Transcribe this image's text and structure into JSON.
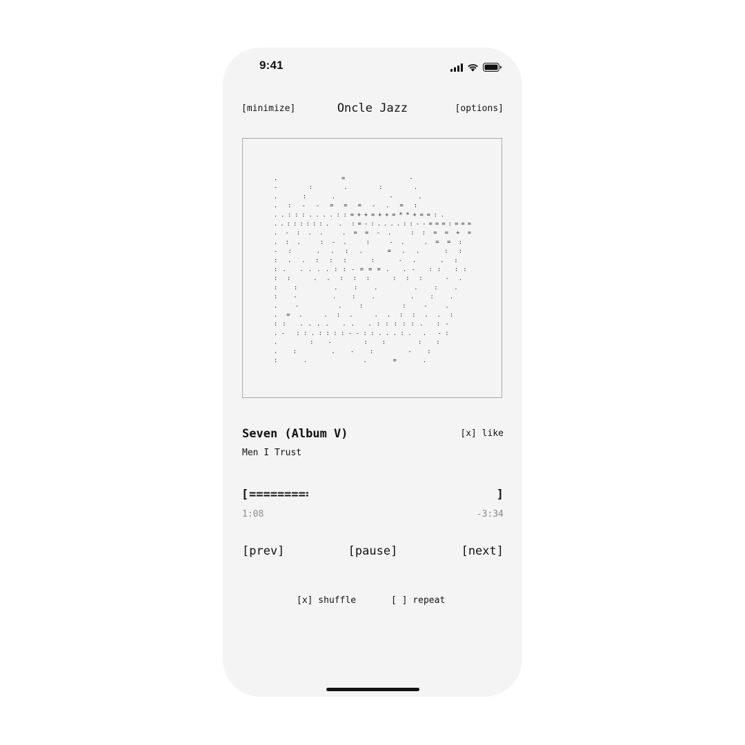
{
  "status_bar": {
    "time": "9:41",
    "icons": [
      "cellular-signal-icon",
      "wifi-icon",
      "battery-icon"
    ]
  },
  "header": {
    "minimize_label": "[minimize]",
    "title": "Oncle Jazz",
    "options_label": "[options]"
  },
  "artwork": {
    "icon": "ascii-art-cover",
    "ascii_lines": [
      "                            .=-",
      "                           -:.:.",
      "                          .:.  -.",
      "                     .:--===-.=:",
      "             ..:::....::=++=++=**+==:.",
      "          ..::::::. .    :=-:....::--===:===",
      "      .-:..            .==-.          ::==+=",
      "     .:.               :-.    :   -.  .==:",
      "     -:                    ..:.   =..   ::",
      "    :..:::                  :   -.     .:",
      "   :.      ....::-===.         .- ::     ::",
      "   ::     ..:::                :::      -.",
      "  ::   .:.                            .:.",
      "  :-  .:.                            .:.",
      " .-  .:                             :-.",
      ".=.   .:.                        ..::..:",
      "::       ....           .. .:::::.   :-",
      ".-          ::.::::--::...:. .       -:",
      " .         :-          ::          ::",
      "          .:         .-:         -:",
      "                     :.        .=."
    ]
  },
  "track": {
    "title": "Seven (Album V)",
    "artist": "Men I Trust",
    "like_label": "[x] like"
  },
  "progress": {
    "open_bracket": "[",
    "fill": "==========================================",
    "close_bracket": "]",
    "fraction": 0.24,
    "elapsed": "1:08",
    "remaining": "-3:34"
  },
  "controls": {
    "prev": "[prev]",
    "pause": "[pause]",
    "next": "[next]"
  },
  "toggles": {
    "shuffle": "[x] shuffle",
    "repeat": "[ ] repeat"
  }
}
